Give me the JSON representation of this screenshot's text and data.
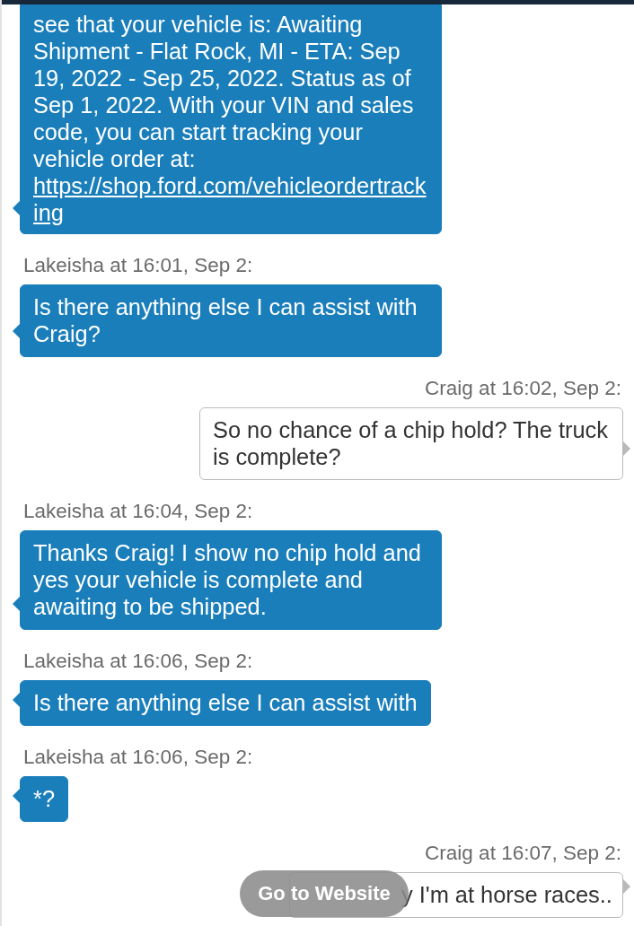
{
  "messages": [
    {
      "kind": "agent",
      "text": "see that your vehicle is: Awaiting Shipment - Flat Rock, MI - ETA: Sep 19, 2022 - Sep 25, 2022. Status as of Sep 1, 2022. With your VIN and sales code, you can start tracking your vehicle order at:",
      "link": "https://shop.ford.com/vehicleordertracking"
    },
    {
      "kind": "agent",
      "sender": "Lakeisha at 16:01, Sep 2:",
      "text": "Is there anything else I can assist with Craig?"
    },
    {
      "kind": "customer",
      "sender": "Craig at 16:02, Sep 2:",
      "text": "So no chance of a chip hold? The truck is complete?"
    },
    {
      "kind": "agent",
      "sender": "Lakeisha at 16:04, Sep 2:",
      "text": "Thanks Craig! I show no chip hold and yes your vehicle is complete and awaiting to be shipped."
    },
    {
      "kind": "agent",
      "sender": "Lakeisha at 16:06, Sep 2:",
      "text": "Is there anything else I can assist with"
    },
    {
      "kind": "agent",
      "sender": "Lakeisha at 16:06, Sep 2:",
      "text": "*?"
    },
    {
      "kind": "customer",
      "sender": "Craig at 16:07, Sep 2:",
      "text": "y I'm at horse races..",
      "covered": true
    }
  ],
  "website_button": {
    "label": "Go to Website"
  }
}
